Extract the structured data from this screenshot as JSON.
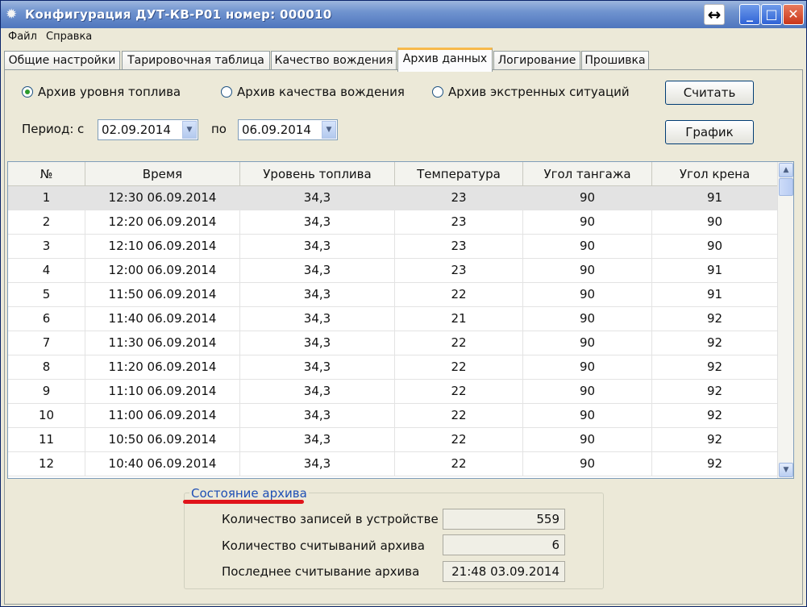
{
  "window": {
    "title": "Конфигурация ДУТ-КВ-Р01 номер: 000010",
    "move_glyph": "↔"
  },
  "menu": [
    "Файл",
    "Справка"
  ],
  "tabs": [
    {
      "label": "Общие настройки"
    },
    {
      "label": "Тарировочная таблица"
    },
    {
      "label": "Качество вождения"
    },
    {
      "label": "Архив данных",
      "active": true
    },
    {
      "label": "Логирование"
    },
    {
      "label": "Прошивка"
    }
  ],
  "archive_type": {
    "options": [
      "Архив уровня топлива",
      "Архив качества вождения",
      "Архив экстренных ситуаций"
    ],
    "selected": "Архив уровня топлива"
  },
  "buttons": {
    "read": "Считать",
    "chart": "График"
  },
  "period": {
    "label": "Период:",
    "from_label": "с",
    "from": "02.09.2014",
    "to_label": "по",
    "to": "06.09.2014"
  },
  "table": {
    "columns": [
      "№",
      "Время",
      "Уровень топлива",
      "Температура",
      "Угол тангажа",
      "Угол крена"
    ],
    "rows": [
      [
        "1",
        "12:30  06.09.2014",
        "34,3",
        "23",
        "90",
        "91"
      ],
      [
        "2",
        "12:20  06.09.2014",
        "34,3",
        "23",
        "90",
        "90"
      ],
      [
        "3",
        "12:10  06.09.2014",
        "34,3",
        "23",
        "90",
        "90"
      ],
      [
        "4",
        "12:00  06.09.2014",
        "34,3",
        "23",
        "90",
        "91"
      ],
      [
        "5",
        "11:50  06.09.2014",
        "34,3",
        "22",
        "90",
        "91"
      ],
      [
        "6",
        "11:40  06.09.2014",
        "34,3",
        "21",
        "90",
        "92"
      ],
      [
        "7",
        "11:30  06.09.2014",
        "34,3",
        "22",
        "90",
        "92"
      ],
      [
        "8",
        "11:20  06.09.2014",
        "34,3",
        "22",
        "90",
        "92"
      ],
      [
        "9",
        "11:10  06.09.2014",
        "34,3",
        "22",
        "90",
        "92"
      ],
      [
        "10",
        "11:00  06.09.2014",
        "34,3",
        "22",
        "90",
        "92"
      ],
      [
        "11",
        "10:50  06.09.2014",
        "34,3",
        "22",
        "90",
        "92"
      ],
      [
        "12",
        "10:40  06.09.2014",
        "34,3",
        "22",
        "90",
        "92"
      ]
    ],
    "selected_row": 0
  },
  "archive_status": {
    "title": "Состояние архива",
    "records_label": "Количество записей в устройстве",
    "records_value": "559",
    "reads_label": "Количество считываний архива",
    "reads_value": "6",
    "last_read_label": "Последнее считывание архива",
    "last_read_value": "21:48  03.09.2014"
  },
  "colors": {
    "highlight_line": "#e0141a",
    "legend_text": "#1f4fb5"
  }
}
